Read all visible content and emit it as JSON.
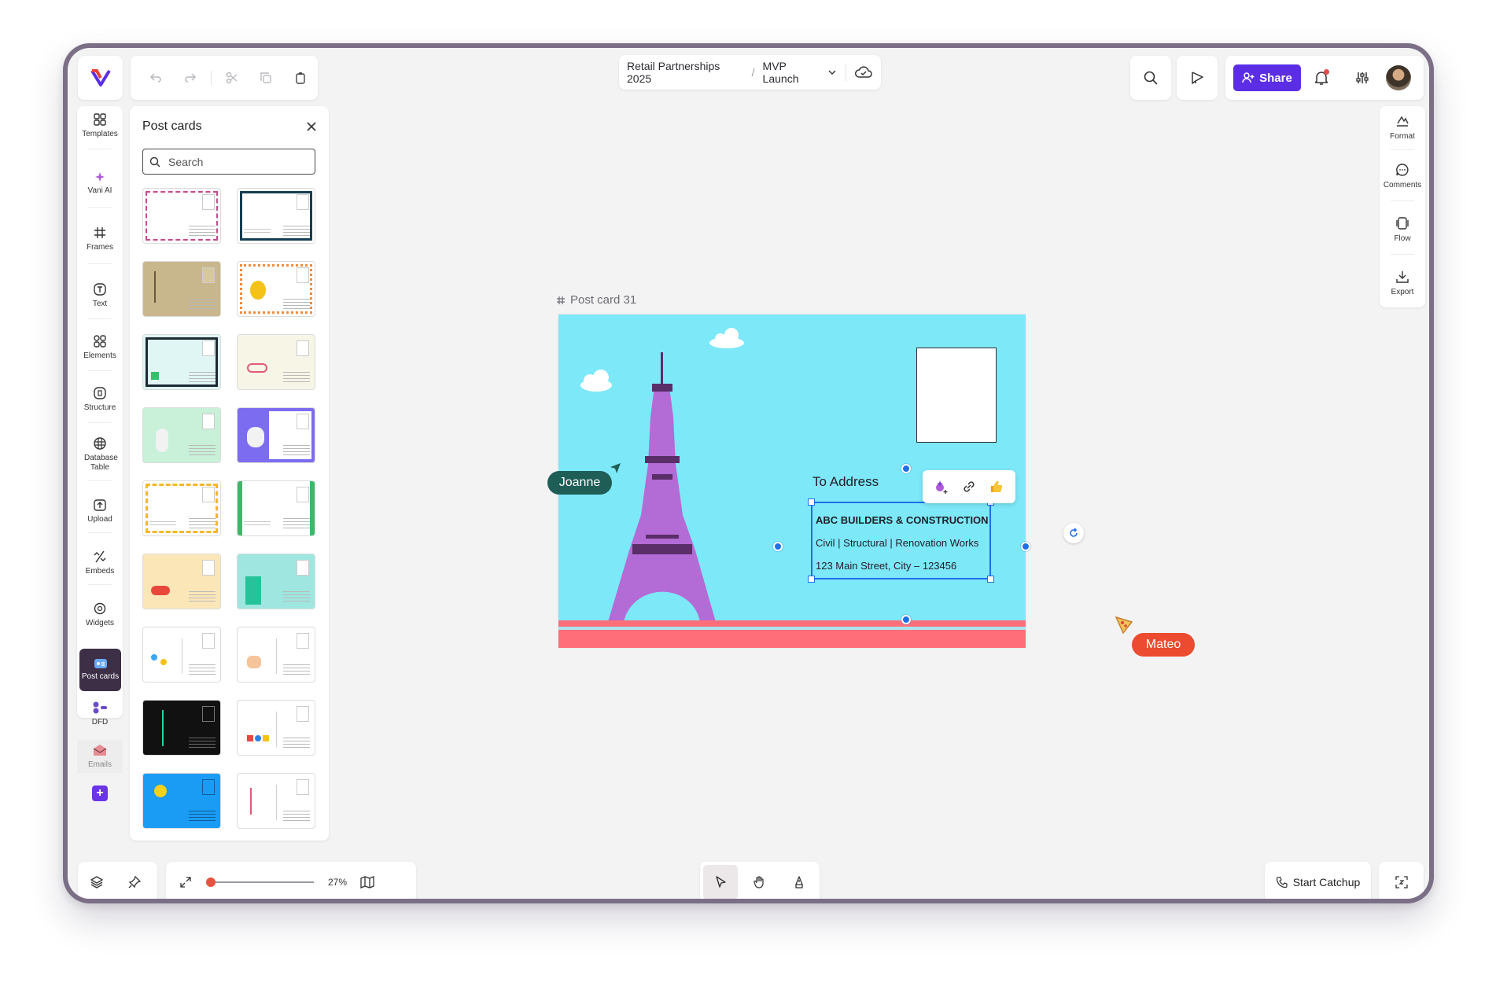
{
  "breadcrumb": {
    "workspace": "Retail Partnerships 2025",
    "separator": "/",
    "board": "MVP Launch"
  },
  "header": {
    "share_label": "Share"
  },
  "left_rail": {
    "items": [
      {
        "label": "Templates",
        "icon": "templates-icon"
      },
      {
        "label": "Vani AI",
        "icon": "sparkle-icon"
      },
      {
        "label": "Frames",
        "icon": "hash-icon"
      },
      {
        "label": "Text",
        "icon": "text-icon"
      },
      {
        "label": "Elements",
        "icon": "shapes-icon"
      },
      {
        "label": "Structure",
        "icon": "structure-icon"
      },
      {
        "label": "Database Table",
        "icon": "database-icon"
      },
      {
        "label": "Upload",
        "icon": "upload-icon"
      },
      {
        "label": "Embeds",
        "icon": "embed-icon"
      },
      {
        "label": "Widgets",
        "icon": "widget-icon"
      },
      {
        "label": "Post cards",
        "icon": "postcard-icon"
      },
      {
        "label": "DFD",
        "icon": "dfd-icon"
      },
      {
        "label": "Emails",
        "icon": "email-icon"
      }
    ]
  },
  "postcards_panel": {
    "title": "Post cards",
    "search_placeholder": "Search"
  },
  "right_rail": {
    "items": [
      {
        "label": "Format",
        "icon": "format-icon"
      },
      {
        "label": "Comments",
        "icon": "comment-icon"
      },
      {
        "label": "Flow",
        "icon": "flow-icon"
      },
      {
        "label": "Export",
        "icon": "export-icon"
      }
    ]
  },
  "canvas": {
    "frame_label": "Post card 31",
    "to_address": "To Address",
    "address_lines": [
      "ABC BUILDERS & CONSTRUCTION",
      "Civil | Structural | Renovation Works",
      "123 Main Street, City – 123456"
    ]
  },
  "collaborators": [
    {
      "name": "Joanne",
      "color": "#1f5e56"
    },
    {
      "name": "Mateo",
      "color": "#ec4b2f"
    }
  ],
  "bottom": {
    "zoom": "27%",
    "catchup_label": "Start Catchup"
  },
  "colors": {
    "accent": "#5b2ee6",
    "selection": "#1e6fe8",
    "card_sky": "#7de8f8",
    "tower": "#b36bd6"
  }
}
